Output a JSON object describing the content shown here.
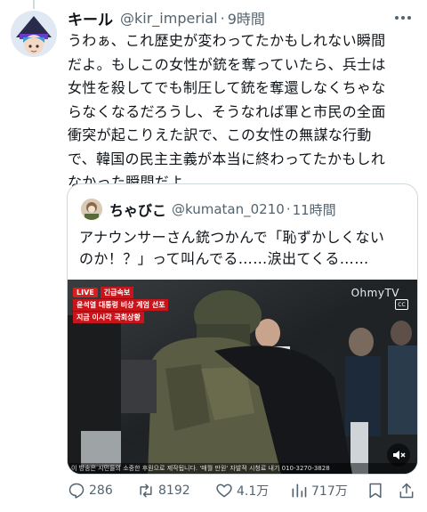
{
  "post": {
    "author_name": "キール",
    "handle": "@kir_imperial",
    "separator": "·",
    "time": "9時間",
    "text": "うわぁ、これ歴史が変わってたかもしれない瞬間\nだよ。もしこの女性が銃を奪っていたら、兵士は\n女性を殺してでも制圧して銃を奪還しなくちゃな\nらなくなるだろうし、そうなれば軍と市民の全面\n衝突が起こりえた訳で、この女性の無謀な行動\nで、韓国の民主主義が本当に終わってたかもしれ\nなかった瞬間だよ。"
  },
  "quote": {
    "author_name": "ちゃびこ",
    "handle": "@kumatan_0210",
    "separator": "·",
    "time": "11時間",
    "text": "アナウンサーさん銃つかんで「恥ずかしくない\nのか！？」って叫んでる……涙出てくる……",
    "media": {
      "live_label": "LIVE",
      "breaking_label": "긴급속보",
      "headline_1": "윤석열 대통령 비상 계엄 선포",
      "headline_2": "지금 이시각 국회상황",
      "watermark": "OhmyTV",
      "cc_label": "CC",
      "caption": "이 방송은 시민들의 소중한 후원으로 제작됩니다.  '매월 만원' 자발적 시청료 내기 010-3270-3828"
    }
  },
  "actions": {
    "replies": "286",
    "reposts": "8192",
    "likes": "4.1万",
    "views": "717万"
  },
  "colors": {
    "text": "#0f1419",
    "secondary": "#536471",
    "border": "#cfd9de",
    "live_red": "#d6201f"
  }
}
